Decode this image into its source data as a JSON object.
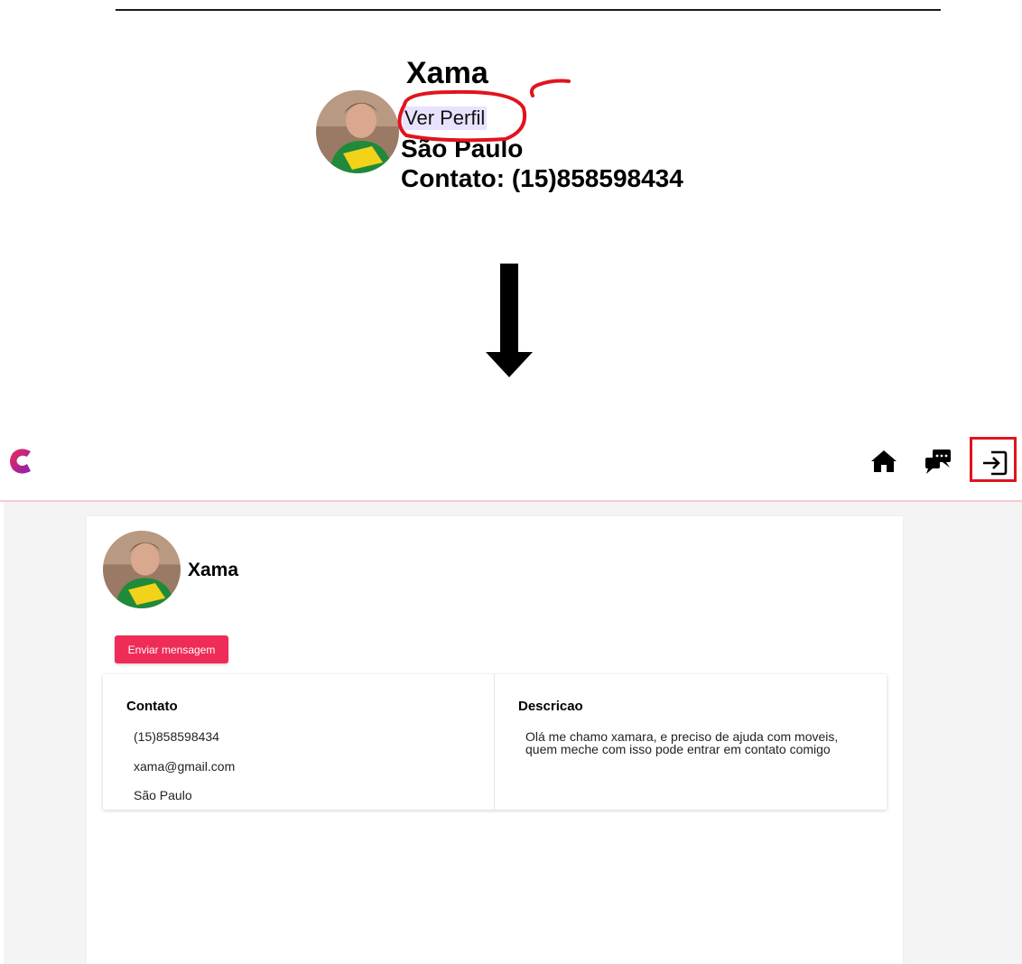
{
  "preview": {
    "name": "Xama",
    "link_label": "Ver Perfil",
    "city": "São Paulo",
    "contact": "Contato: (15)858598434"
  },
  "nav": {
    "icons": [
      "logo-icon",
      "home-icon",
      "chat-icon",
      "logout-icon"
    ]
  },
  "profile": {
    "name": "Xama",
    "send_button": "Enviar mensagem",
    "contact_title": "Contato",
    "phone": "(15)858598434",
    "email": "xama@gmail.com",
    "city": "São Paulo",
    "description_title": "Descricao",
    "description": "Olá me chamo xamara, e preciso de ajuda com moveis, quem meche com isso pode entrar em contato comigo"
  },
  "colors": {
    "accent": "#ef2b57",
    "annotation": "#e0141e",
    "nav_border": "#f6c9cf",
    "page_background": "#f4f4f4"
  }
}
